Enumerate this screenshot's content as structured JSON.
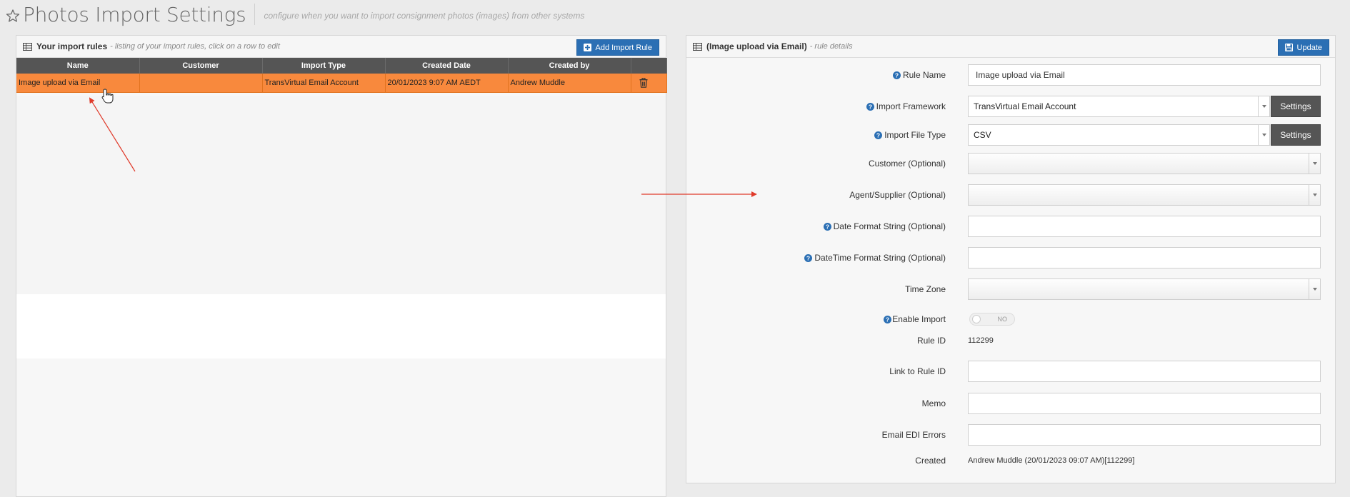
{
  "header": {
    "title": "Photos Import Settings",
    "subtitle": "configure when you want to import consignment photos (images) from other systems"
  },
  "left_panel": {
    "title": "Your import rules",
    "subtitle": "- listing of your import rules, click on a row to edit",
    "add_button": "Add Import Rule",
    "columns": [
      "Name",
      "Customer",
      "Import Type",
      "Created Date",
      "Created by"
    ],
    "rows": [
      {
        "name": "Image upload via Email",
        "customer": "",
        "import_type": "TransVirtual Email Account",
        "created_date": "20/01/2023 9:07 AM AEDT",
        "created_by": "Andrew Muddle"
      }
    ]
  },
  "right_panel": {
    "title": "(Image upload via Email)",
    "subtitle": "- rule details",
    "update_button": "Update",
    "fields": {
      "rule_name": {
        "label": "Rule Name",
        "value": "Image upload via Email"
      },
      "import_framework": {
        "label": "Import Framework",
        "value": "TransVirtual Email Account",
        "button": "Settings"
      },
      "import_file_type": {
        "label": "Import File Type",
        "value": "CSV",
        "button": "Settings"
      },
      "customer": {
        "label": "Customer (Optional)",
        "value": ""
      },
      "agent_supplier": {
        "label": "Agent/Supplier (Optional)",
        "value": ""
      },
      "date_format": {
        "label": "Date Format String (Optional)",
        "value": ""
      },
      "datetime_format": {
        "label": "DateTime Format String (Optional)",
        "value": ""
      },
      "time_zone": {
        "label": "Time Zone",
        "value": ""
      },
      "enable_import": {
        "label": "Enable Import",
        "state": "NO"
      },
      "rule_id": {
        "label": "Rule ID",
        "value": "112299"
      },
      "link_rule_id": {
        "label": "Link to Rule ID",
        "value": ""
      },
      "memo": {
        "label": "Memo",
        "value": ""
      },
      "email_edi_errors": {
        "label": "Email EDI Errors",
        "value": ""
      },
      "created": {
        "label": "Created",
        "value": "Andrew Muddle (20/01/2023 09:07 AM)[112299]"
      }
    }
  },
  "colors": {
    "selected_row": "#f8893d",
    "primary_button": "#2b6fb4",
    "header_bar": "#555555",
    "annotation_arrow": "#e03a2a"
  }
}
